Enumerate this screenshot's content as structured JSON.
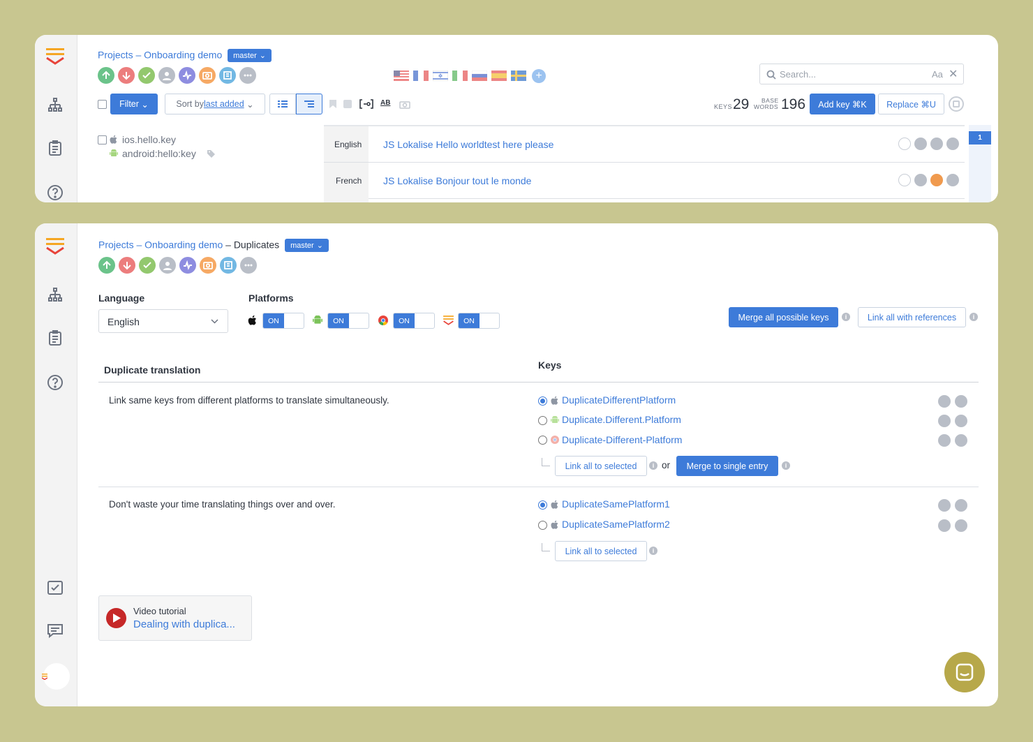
{
  "top_panel": {
    "breadcrumb": {
      "projects": "Projects",
      "separator": "–",
      "project": "Onboarding demo"
    },
    "branch": "master",
    "search": {
      "placeholder": "Search...",
      "case_label": "Aa"
    },
    "toolbar": {
      "filter_label": "Filter",
      "sort_prefix": "Sort by ",
      "sort_value": "last added",
      "ab_label": "AB"
    },
    "stats": {
      "keys_label": "KEYS",
      "keys_value": "29",
      "base_label": "BASE",
      "words_label": "WORDS",
      "words_value": "196"
    },
    "add_key_label": "Add key ⌘K",
    "replace_label": "Replace ⌘U",
    "key": {
      "ios_name": "ios.hello.key",
      "android_name": "android:hello:key"
    },
    "translations": [
      {
        "language": "English",
        "text": "JS Lokalise Hello worldtest here please"
      },
      {
        "language": "French",
        "text": "JS Lokalise Bonjour tout le monde"
      }
    ],
    "page_badge": "1"
  },
  "bottom_panel": {
    "breadcrumb": {
      "projects": "Projects",
      "separator": "–",
      "project": "Onboarding demo",
      "page": "Duplicates"
    },
    "branch": "master",
    "language_label": "Language",
    "language_value": "English",
    "platforms_label": "Platforms",
    "toggle_label": "ON",
    "merge_all_label": "Merge all possible keys",
    "link_refs_label": "Link all with references",
    "table": {
      "col1": "Duplicate translation",
      "col2": "Keys"
    },
    "groups": [
      {
        "description": "Link same keys from different platforms to translate simultaneously.",
        "keys": [
          "DuplicateDifferentPlatform",
          "Duplicate.Different.Platform",
          "Duplicate-Different-Platform"
        ],
        "link_label": "Link all to selected",
        "or_label": "or",
        "merge_label": "Merge to single entry"
      },
      {
        "description": "Don't waste your time translating things over and over.",
        "keys": [
          "DuplicateSamePlatform1",
          "DuplicateSamePlatform2"
        ],
        "link_label": "Link all to selected"
      }
    ],
    "video": {
      "title": "Video tutorial",
      "link": "Dealing with duplica..."
    }
  },
  "colors": {
    "accent": "#3d7bd9",
    "page_bg": "#c8c690",
    "chat_button": "#b7a84a"
  }
}
